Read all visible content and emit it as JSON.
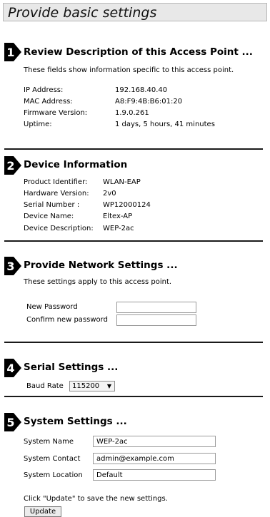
{
  "page": {
    "title": "Provide basic settings"
  },
  "sections": {
    "s1": {
      "number": "1",
      "heading": "Review Description of this Access Point ...",
      "description": "These fields show information specific to this access point.",
      "rows": [
        {
          "label": "IP Address:",
          "value": "192.168.40.40"
        },
        {
          "label": "MAC Address:",
          "value": "A8:F9:4B:B6:01:20"
        },
        {
          "label": "Firmware Version:",
          "value": "1.9.0.261"
        },
        {
          "label": "Uptime:",
          "value": "1 days, 5 hours, 41 minutes"
        }
      ]
    },
    "s2": {
      "number": "2",
      "heading": "Device Information",
      "rows": [
        {
          "label": "Product Identifier:",
          "value": "WLAN-EAP"
        },
        {
          "label": "Hardware Version:",
          "value": "2v0"
        },
        {
          "label": "Serial Number :",
          "value": "WP12000124"
        },
        {
          "label": "Device Name:",
          "value": "Eltex-AP"
        },
        {
          "label": "Device Description:",
          "value": "WEP-2ac"
        }
      ]
    },
    "s3": {
      "number": "3",
      "heading": "Provide Network Settings ...",
      "description": "These settings apply to this access point.",
      "fields": [
        {
          "label": "New Password",
          "value": ""
        },
        {
          "label": "Confirm new password",
          "value": ""
        }
      ]
    },
    "s4": {
      "number": "4",
      "heading": "Serial Settings ...",
      "baud_label": "Baud Rate",
      "baud_value": "115200"
    },
    "s5": {
      "number": "5",
      "heading": "System Settings ...",
      "fields": [
        {
          "label": "System Name",
          "value": "WEP-2ac"
        },
        {
          "label": "System Contact",
          "value": "admin@example.com"
        },
        {
          "label": "System Location",
          "value": "Default"
        }
      ],
      "hint": "Click \"Update\" to save the new settings.",
      "update_label": "Update"
    }
  }
}
